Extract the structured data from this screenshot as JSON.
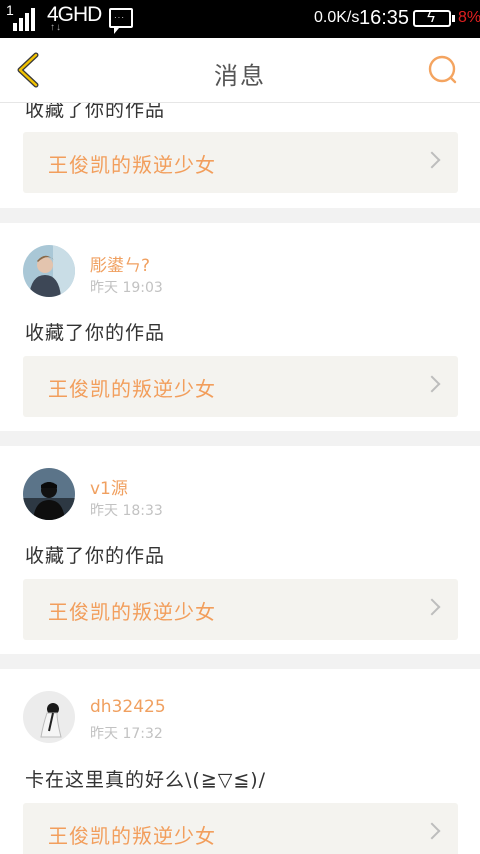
{
  "status_bar": {
    "sim_slot": "1",
    "network": "4GHD",
    "data_speed": "0.0K/s",
    "time": "16:35",
    "battery_pct": "8%"
  },
  "header": {
    "title": "消息",
    "back_icon": "chevron-left-icon",
    "search_icon": "search-icon",
    "accent_color": "#f4a460"
  },
  "messages": [
    {
      "action_text": "收藏了你的作品",
      "work_title": "王俊凯的叛逆少女"
    },
    {
      "user": "彫鍙ㄣ?",
      "time": "昨天 19:03",
      "action_text": "收藏了你的作品",
      "work_title": "王俊凯的叛逆少女"
    },
    {
      "user": "v1源",
      "time": "昨天 18:33",
      "action_text": "收藏了你的作品",
      "work_title": "王俊凯的叛逆少女"
    },
    {
      "user": "dh32425",
      "time": "昨天 17:32",
      "action_text": "卡在这里真的好么\\(≧▽≦)/",
      "work_title": "王俊凯的叛逆少女"
    }
  ]
}
